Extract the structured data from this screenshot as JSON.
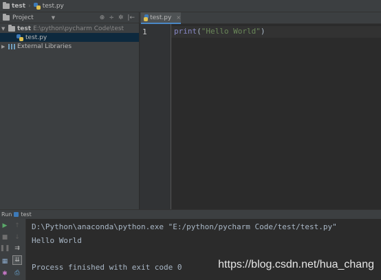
{
  "navbar": {
    "project": "test",
    "file": "test.py"
  },
  "project_panel": {
    "header_label": "Project",
    "tools": [
      "⊕",
      "÷",
      "✲",
      "|←"
    ],
    "tree": [
      {
        "name": "test",
        "path": "E:\\python\\pycharm Code\\test"
      },
      {
        "name": "test.py"
      },
      {
        "name": "External Libraries"
      }
    ]
  },
  "editor": {
    "tab_label": "test.py",
    "line_number": "1",
    "code": {
      "fn": "print",
      "open": "(",
      "string": "\"Hello World\"",
      "close": ")"
    }
  },
  "run": {
    "header_label": "Run",
    "config_name": "test",
    "lines": [
      "D:\\Python\\anaconda\\python.exe \"E:/python/pycharm Code/test/test.py\"",
      "Hello World",
      "Process finished with exit code 0"
    ]
  },
  "watermark": "https://blog.csdn.net/hua_chang",
  "colors": {
    "accent": "#4a88c7",
    "play": "#59a869",
    "selection": "#0d293e"
  }
}
